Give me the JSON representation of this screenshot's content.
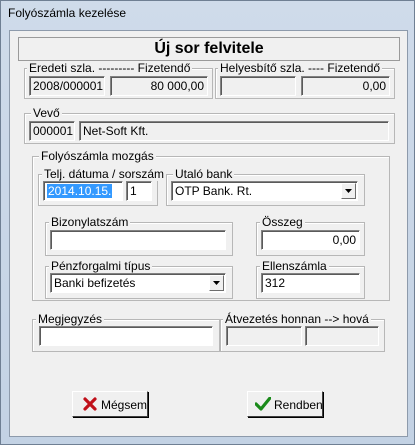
{
  "window": {
    "title": "Folyószámla kezelése"
  },
  "header": {
    "title": "Új sor felvitele"
  },
  "original": {
    "label_left": "Eredeti szla.",
    "label_right": "Fizetendő",
    "invoice_no": "2008/000001",
    "amount": "80 000,00"
  },
  "correcting": {
    "label_left": "Helyesbítő szla.",
    "label_right": "Fizetendő",
    "invoice_no": "",
    "amount": "0,00"
  },
  "customer": {
    "label": "Vevő",
    "code": "000001",
    "name": "Net-Soft Kft."
  },
  "movement": {
    "label": "Folyószámla mozgás",
    "date_label": "Telj. dátuma / sorszám",
    "date": "2014.10.15.",
    "sequence": "1",
    "bank_label": "Utaló bank",
    "bank_value": "OTP Bank. Rt.",
    "doc_label": "Bizonylatszám",
    "doc_value": "",
    "amount_label": "Összeg",
    "amount_value": "0,00",
    "payment_label": "Pénzforgalmi típus",
    "payment_value": "Banki befizetés",
    "account_label": "Ellenszámla",
    "account_value": "312"
  },
  "note": {
    "label": "Megjegyzés",
    "value": ""
  },
  "transfer": {
    "label": "Átvezetés honnan  --> hová",
    "from": "",
    "to": ""
  },
  "buttons": {
    "cancel": "Mégsem",
    "ok": "Rendben"
  },
  "colors": {
    "selection": "#3399ff",
    "cancel_icon": "#c0101a",
    "ok_icon": "#1a8a1a"
  }
}
